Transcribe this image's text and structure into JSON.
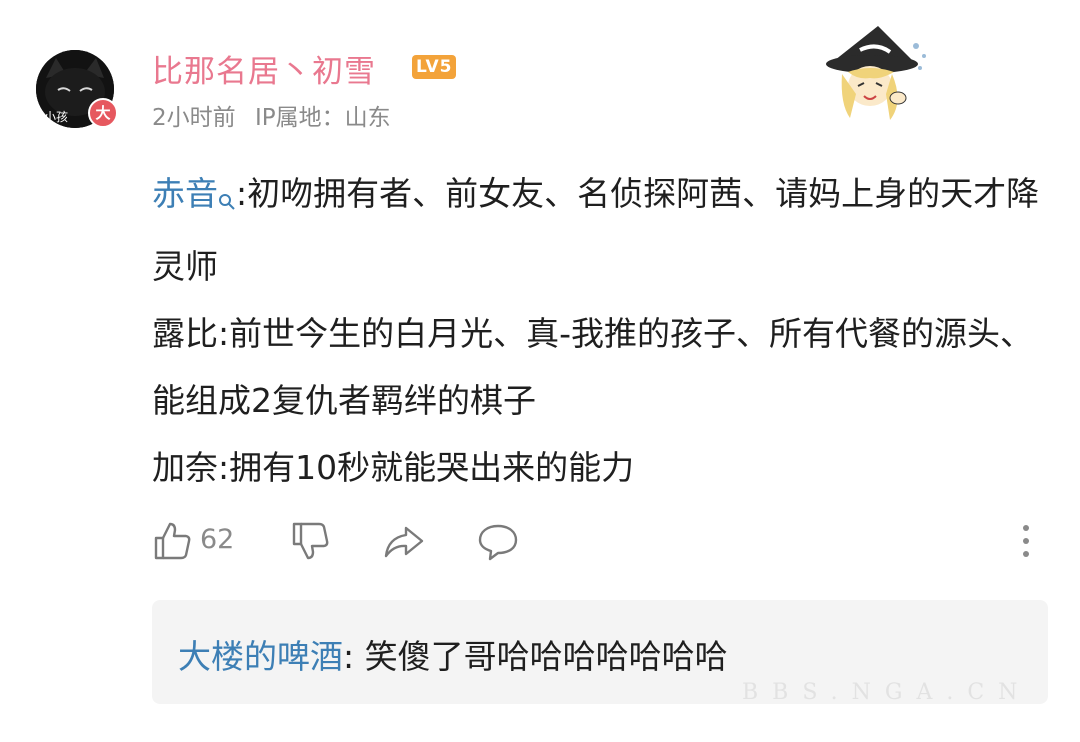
{
  "comment": {
    "author": {
      "name": "比那名居丶初雪",
      "level_badge": "LV5",
      "avatar_tag": "小孩",
      "vip_badge": "大"
    },
    "time": "2小时前",
    "ip_location": "IP属地：山东",
    "body": [
      {
        "mention": "赤音",
        "text": ":初吻拥有者、前女友、名侦探阿茜、请妈上身的天才降灵师"
      },
      {
        "mention": "",
        "text": "露比:前世今生的白月光、真-我推的孩子、所有代餐的源头、能组成2复仇者羁绊的棋子"
      },
      {
        "mention": "",
        "text": "加奈:拥有10秒就能哭出来的能力"
      }
    ],
    "actions": {
      "like_count": "62"
    },
    "reply": {
      "author": "大楼的啤酒",
      "text": ": 笑傻了哥哈哈哈哈哈哈哈"
    }
  },
  "watermark": "BBS.NGA.CN",
  "colors": {
    "username": "#e9788f",
    "mention": "#3d7fb5",
    "level_badge": "#f3a33a",
    "meta": "#8a8a8a",
    "reply_bg": "#f4f4f4"
  },
  "icons": [
    "thumbs-up-icon",
    "thumbs-down-icon",
    "share-icon",
    "reply-bubble-icon",
    "more-vertical-icon",
    "search-icon"
  ]
}
